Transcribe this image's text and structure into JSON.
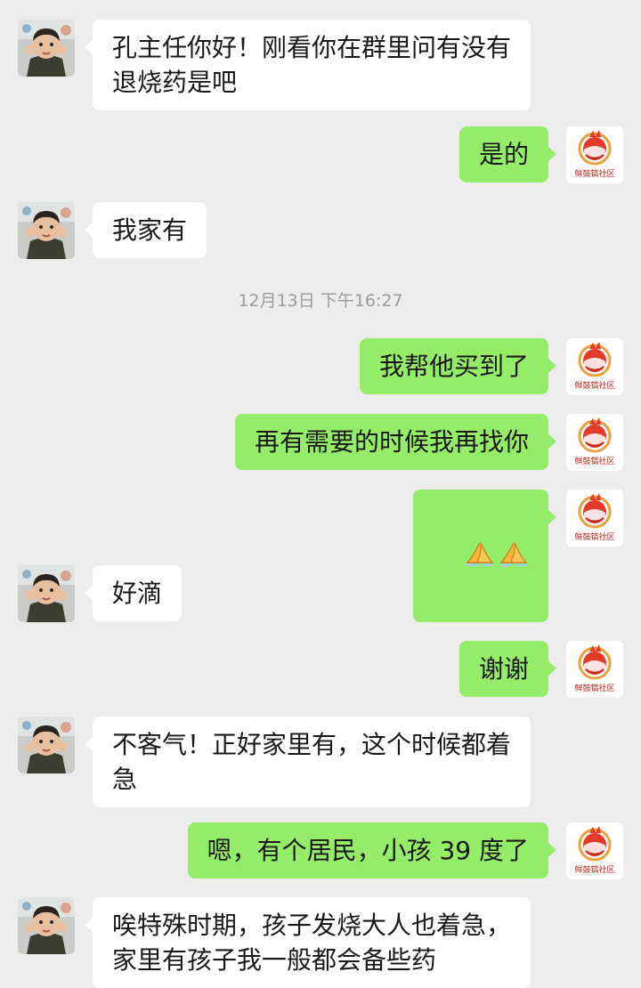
{
  "timestamp": "12月13日 下午16:27",
  "contact": {
    "avatar_icon": "child-photo-avatar-icon"
  },
  "me": {
    "avatar_icon": "community-logo-avatar-icon",
    "logo_caption": "鲜鼓镐社区"
  },
  "colors": {
    "background": "#ededed",
    "incoming_bubble": "#ffffff",
    "outgoing_bubble": "#95ec69",
    "timestamp_text": "#9c9c9c"
  },
  "messages": [
    {
      "side": "in",
      "text": "孔主任你好！刚看你在群里问有没有\n退烧药是吧"
    },
    {
      "side": "out",
      "text": "是的"
    },
    {
      "side": "in",
      "text": "我家有"
    },
    {
      "side": "out",
      "text": "我帮他买到了"
    },
    {
      "side": "out",
      "text": "再有需要的时候我再找你"
    },
    {
      "side": "out",
      "emoji": [
        "praying-hands-icon",
        "praying-hands-icon"
      ]
    },
    {
      "side": "in",
      "text": "好滴"
    },
    {
      "side": "out",
      "text": "谢谢"
    },
    {
      "side": "in",
      "text": "不客气！正好家里有，这个时候都着\n急"
    },
    {
      "side": "out",
      "text": "嗯，有个居民，小孩 39 度了"
    },
    {
      "side": "in",
      "text": "唉特殊时期，孩子发烧大人也着急，\n家里有孩子我一般都会备些药"
    }
  ]
}
